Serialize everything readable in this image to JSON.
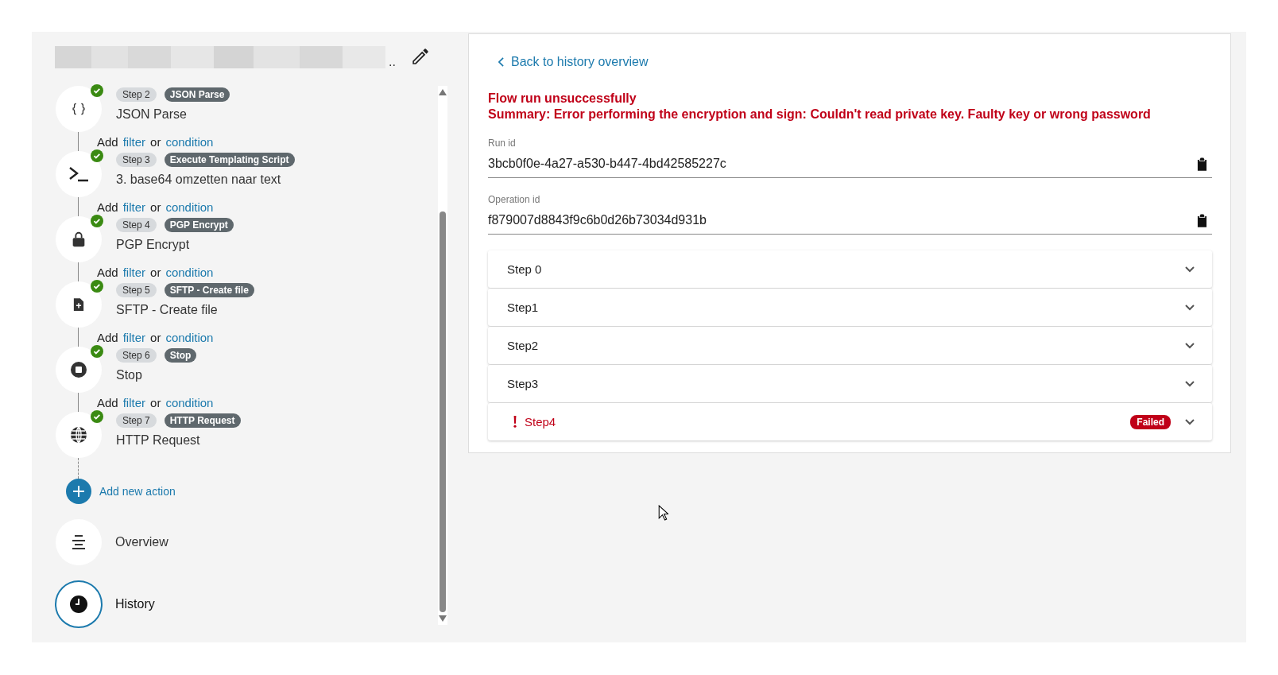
{
  "flow_title": {
    "ellipsis": ".."
  },
  "steps": [
    {
      "step": "Step 2",
      "type": "JSON Parse",
      "name": "JSON Parse",
      "kind": "braces",
      "succeeded": true,
      "add_row": {
        "add": "Add",
        "filter": "filter",
        "or": "or",
        "condition": "condition"
      }
    },
    {
      "step": "Step 3",
      "type": "Execute Templating Script",
      "name": "3. base64 omzetten naar text",
      "kind": "terminal",
      "succeeded": true,
      "add_row": {
        "add": "Add",
        "filter": "filter",
        "or": "or",
        "condition": "condition"
      }
    },
    {
      "step": "Step 4",
      "type": "PGP Encrypt",
      "name": "PGP Encrypt",
      "kind": "lock",
      "succeeded": true,
      "add_row": {
        "add": "Add",
        "filter": "filter",
        "or": "or",
        "condition": "condition"
      }
    },
    {
      "step": "Step 5",
      "type": "SFTP - Create file",
      "name": "SFTP - Create file",
      "kind": "file",
      "succeeded": true,
      "add_row": {
        "add": "Add",
        "filter": "filter",
        "or": "or",
        "condition": "condition"
      }
    },
    {
      "step": "Step 6",
      "type": "Stop",
      "name": "Stop",
      "kind": "stop",
      "succeeded": true,
      "add_row": {
        "add": "Add",
        "filter": "filter",
        "or": "or",
        "condition": "condition"
      }
    },
    {
      "step": "Step 7",
      "type": "HTTP Request",
      "name": "HTTP Request",
      "kind": "globe",
      "succeeded": true
    }
  ],
  "add_action": "Add new action",
  "nav": [
    {
      "label": "Overview",
      "kind": "list",
      "selected": false
    },
    {
      "label": "History",
      "kind": "clock",
      "selected": true
    }
  ],
  "back_link": "Back to history overview",
  "error": {
    "title": "Flow run unsuccessfully",
    "summary": "Summary: Error performing the encryption and sign: Couldn't read private key. Faulty key or wrong password"
  },
  "fields": [
    {
      "label": "Run id",
      "value": "3bcb0f0e-4a27-a530-b447-4bd42585227c"
    },
    {
      "label": "Operation id",
      "value": "f879007d8843f9c6b0d26b73034d931b"
    }
  ],
  "run_steps": [
    {
      "label": "Step 0",
      "failed": false
    },
    {
      "label": "Step1",
      "failed": false
    },
    {
      "label": "Step2",
      "failed": false
    },
    {
      "label": "Step3",
      "failed": false
    },
    {
      "label": "Step4",
      "failed": true,
      "badge": "Failed"
    }
  ]
}
